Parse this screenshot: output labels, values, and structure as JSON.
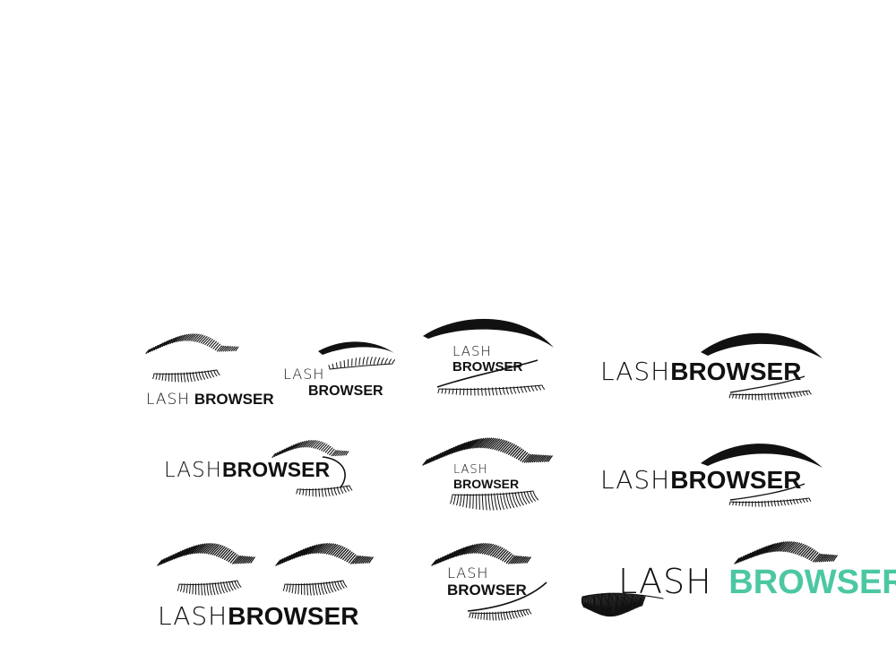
{
  "brand": {
    "light": "LASH",
    "bold": "BROWSER"
  },
  "colors": {
    "ink": "#111111",
    "accent": "#4cc7a3",
    "background": "#ffffff"
  },
  "logos": [
    {
      "id": "logo-1",
      "variant": "closed-eye-brow-above-text"
    },
    {
      "id": "logo-2",
      "variant": "thin-brow-lash-stacked-text"
    },
    {
      "id": "logo-3",
      "variant": "bold-brow-eye-outline-stacked-text"
    },
    {
      "id": "logo-4",
      "variant": "wide-inline-text-brow-lash"
    },
    {
      "id": "logo-5",
      "variant": "inline-text-curl-eye"
    },
    {
      "id": "logo-6",
      "variant": "feathered-brow-stacked-text-lash"
    },
    {
      "id": "logo-7",
      "variant": "inline-text-bold-brow-lash"
    },
    {
      "id": "logo-8",
      "variant": "two-eyes-closed-wide-text"
    },
    {
      "id": "logo-9",
      "variant": "brow-stacked-text-lash"
    },
    {
      "id": "logo-10",
      "variant": "accent-color-text-lash-brow"
    }
  ]
}
